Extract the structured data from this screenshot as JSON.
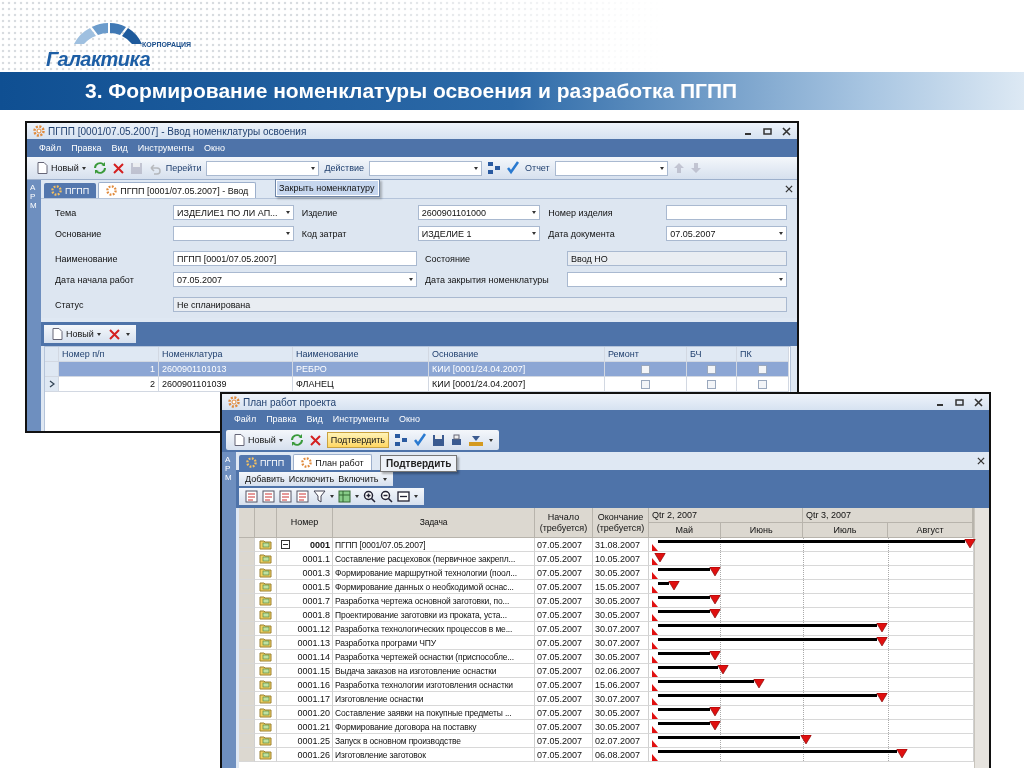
{
  "slide": {
    "logo_caption": "КОРПОРАЦИЯ",
    "logo_name": "Галактика",
    "title": "3. Формирование номенклатуры освоения и разработка ПГПП"
  },
  "nomenclature_window": {
    "title": "ПГПП [0001/07.05.2007] - Ввод номенклатуры освоения",
    "menu": [
      "Файл",
      "Правка",
      "Вид",
      "Инструменты",
      "Окно"
    ],
    "toolbar": {
      "new_button": "Новый",
      "goto_label": "Перейти",
      "action_label": "Действие",
      "report_label": "Отчет"
    },
    "goto_dropdown": {
      "items": [
        "Закрыть номенклатуру"
      ]
    },
    "side_tab": "АРМ",
    "tabs": [
      {
        "label": "ПГПП",
        "selected": false
      },
      {
        "label": "ПГПП [0001/07.05.2007] - Ввод",
        "selected": true
      }
    ],
    "form_groups": [
      [
        [
          {
            "kind": "combo",
            "label": "Тема",
            "value": "ИЗДЕЛИЕ1 ПО ЛИ АП..."
          },
          {
            "kind": "combo",
            "label": "Изделие",
            "value": "2600901101000"
          },
          {
            "kind": "text",
            "label": "Номер изделия"
          }
        ],
        [
          {
            "kind": "combo",
            "label": "Основание"
          },
          {
            "kind": "combo",
            "label": "Код затрат",
            "value": "ИЗДЕЛИЕ 1"
          },
          {
            "kind": "combo",
            "label": "Дата документа",
            "value": "07.05.2007"
          }
        ]
      ],
      [
        [
          {
            "kind": "text",
            "label": "Наименование",
            "value": "ПГПП [0001/07.05.2007]"
          },
          {
            "kind": "readonly",
            "label": "Состояние",
            "value": "Ввод НО"
          }
        ],
        [
          {
            "kind": "combo",
            "label": "Дата начала работ",
            "value": "07.05.2007"
          },
          {
            "kind": "combo",
            "label": "Дата закрытия номенклатуры"
          }
        ]
      ],
      [
        [
          {
            "kind": "readonly",
            "label": "Статус",
            "value": "Не спланирована"
          }
        ]
      ]
    ],
    "grid_toolbar": {
      "new_button": "Новый"
    },
    "table": {
      "columns": [
        "Номер п/п",
        "Номенклатура",
        "Наименование",
        "Основание",
        "Ремонт",
        "БЧ",
        "ПК"
      ],
      "rows": [
        {
          "number": "1",
          "nomenclature": "2600901101013",
          "name": "РЕБРО",
          "basis": "КИИ [0001/24.04.2007]",
          "repair": false,
          "bch": false,
          "pk": false,
          "selected": true,
          "current": false
        },
        {
          "number": "2",
          "nomenclature": "2600901101039",
          "name": "ФЛАНЕЦ",
          "basis": "КИИ [0001/24.04.2007]",
          "repair": false,
          "bch": false,
          "pk": false,
          "selected": false,
          "current": true
        }
      ]
    }
  },
  "plan_window": {
    "title": "План работ проекта",
    "menu": [
      "Файл",
      "Правка",
      "Вид",
      "Инструменты",
      "Окно"
    ],
    "toolbar": {
      "new_button": "Новый",
      "confirm_button": "Подтвердить",
      "confirm_hovered": true
    },
    "tooltip": "Подтвердить",
    "side_tab": "АРМ",
    "tabs": [
      {
        "label": "ПГПП",
        "selected": false
      },
      {
        "label": "План работ",
        "selected": true
      }
    ],
    "actions": [
      "Добавить",
      "Исключить",
      "Включить"
    ],
    "table": {
      "columns": [
        "Номер",
        "Задача",
        "Начало (требуется)",
        "Окончание (требуется)"
      ],
      "quarters": [
        "Qtr 2, 2007",
        "Qtr 3, 2007"
      ],
      "months": [
        "Май",
        "Июнь",
        "Июль",
        "Август"
      ],
      "rows": [
        {
          "kind": "summary",
          "expanded": true,
          "number": "0001",
          "task": "ПГПП [0001/07.05.2007]",
          "start": "07.05.2007",
          "end": "31.08.2007"
        },
        {
          "kind": "task",
          "number": "0001.1",
          "task": "Составление расцеховок (первичное закрепл...",
          "start": "07.05.2007",
          "end": "10.05.2007"
        },
        {
          "kind": "task",
          "number": "0001.3",
          "task": "Формирование маршрутной технологии (поол...",
          "start": "07.05.2007",
          "end": "30.05.2007"
        },
        {
          "kind": "task",
          "number": "0001.5",
          "task": "Формирование данных о необходимой  оснас...",
          "start": "07.05.2007",
          "end": "15.05.2007"
        },
        {
          "kind": "task",
          "number": "0001.7",
          "task": "Разработка чертежа основной заготовки, по...",
          "start": "07.05.2007",
          "end": "30.05.2007"
        },
        {
          "kind": "task",
          "number": "0001.8",
          "task": "Проектирование заготовки из проката, уста...",
          "start": "07.05.2007",
          "end": "30.05.2007"
        },
        {
          "kind": "task",
          "number": "0001.12",
          "task": "Разработка технологических процессов в ме...",
          "start": "07.05.2007",
          "end": "30.07.2007"
        },
        {
          "kind": "task",
          "number": "0001.13",
          "task": "Разработка програми ЧПУ",
          "start": "07.05.2007",
          "end": "30.07.2007"
        },
        {
          "kind": "task",
          "number": "0001.14",
          "task": "Разработка чертежей оснастки (приспособле...",
          "start": "07.05.2007",
          "end": "30.05.2007"
        },
        {
          "kind": "task",
          "number": "0001.15",
          "task": "Выдача заказов на изготовление оснастки",
          "start": "07.05.2007",
          "end": "02.06.2007"
        },
        {
          "kind": "task",
          "number": "0001.16",
          "task": "Разработка технологии изготовления оснастки",
          "start": "07.05.2007",
          "end": "15.06.2007"
        },
        {
          "kind": "task",
          "number": "0001.17",
          "task": "Изготовление оснастки",
          "start": "07.05.2007",
          "end": "30.07.2007"
        },
        {
          "kind": "task",
          "number": "0001.20",
          "task": "Составление заявки на покупные предметы ...",
          "start": "07.05.2007",
          "end": "30.05.2007"
        },
        {
          "kind": "task",
          "number": "0001.21",
          "task": "Формирование договора на поставку",
          "start": "07.05.2007",
          "end": "30.05.2007"
        },
        {
          "kind": "task",
          "number": "0001.25",
          "task": "Запуск в основном производстве",
          "start": "07.05.2007",
          "end": "02.07.2007"
        },
        {
          "kind": "task",
          "number": "0001.26",
          "task": "Изготовление заготовок",
          "start": "07.05.2007",
          "end": "06.08.2007"
        }
      ]
    }
  }
}
